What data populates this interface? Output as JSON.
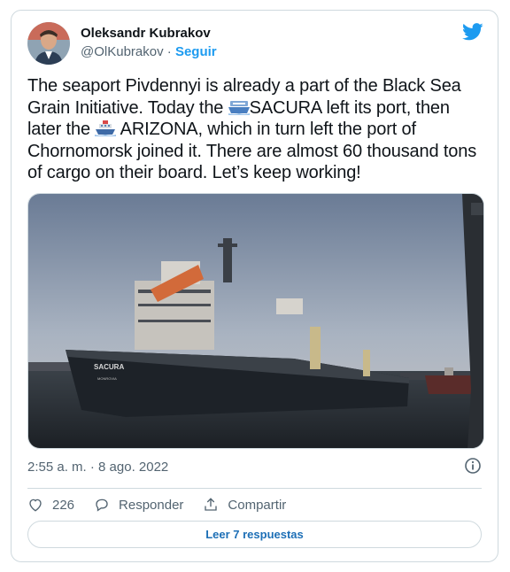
{
  "author": {
    "name": "Oleksandr Kubrakov",
    "handle": "@OlKubrakov",
    "separator": " · ",
    "follow_label": "Seguir"
  },
  "tweet": {
    "part1": "The seaport Pivdennyi is already a part of the Black Sea Grain Initiative. Today the ",
    "ship1": "SACURA",
    "part2": " left its port, then later the ",
    "ship2": " ARIZONA",
    "part3": ", which in turn left the port of Chornomorsk joined it. There are almost 60 thousand tons of cargo on their board. Let’s  keep working!",
    "emoji1": "ship-emoji",
    "emoji2": "passenger-ship-emoji"
  },
  "photo": {
    "hull_name": "SACURA",
    "hull_port": "MONROVIA"
  },
  "timestamp": "2:55 a. m. · 8 ago. 2022",
  "actions": {
    "like_count": "226",
    "reply_label": "Responder",
    "share_label": "Compartir"
  },
  "read_replies_label": "Leer 7 respuestas",
  "colors": {
    "accent": "#1d9bf0",
    "text": "#0f1419",
    "muted": "#536471",
    "border": "#cfd9de"
  },
  "icons": [
    "twitter-bird-icon",
    "info-icon",
    "heart-icon",
    "reply-icon",
    "share-icon"
  ]
}
